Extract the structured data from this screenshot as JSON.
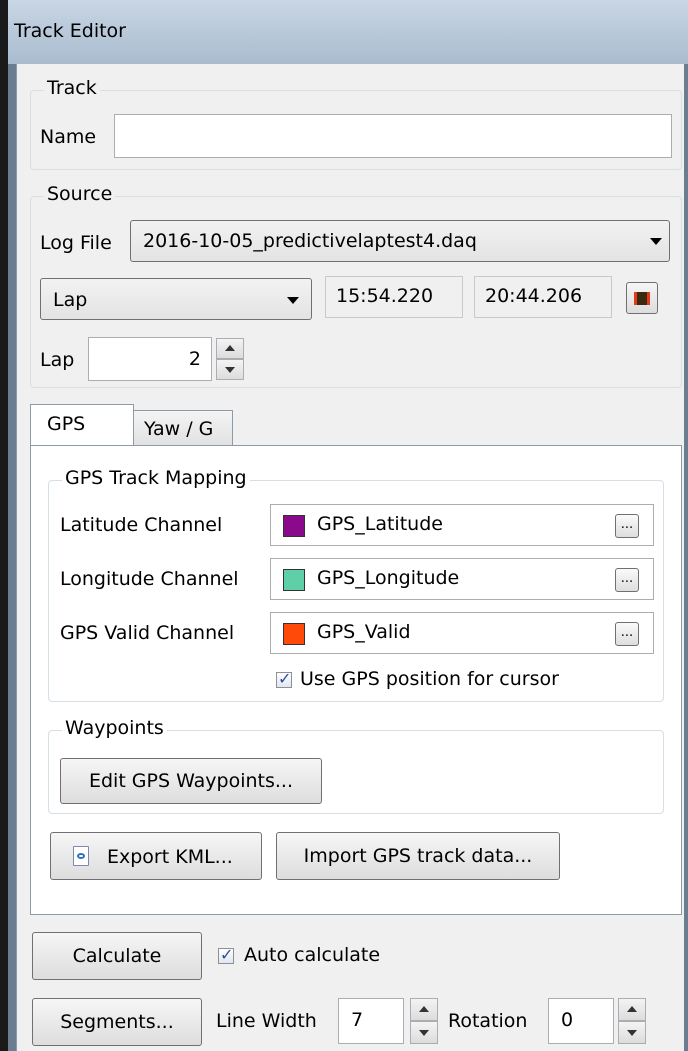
{
  "window": {
    "title": "Track Editor"
  },
  "track": {
    "group_label": "Track",
    "name_label": "Name",
    "name_value": ""
  },
  "source": {
    "group_label": "Source",
    "log_file_label": "Log File",
    "log_file_value": "2016-10-05_predictivelaptest4.daq",
    "range_mode": "Lap",
    "start_time": "15:54.220",
    "end_time": "20:44.206",
    "lap_label": "Lap",
    "lap_value": "2"
  },
  "tabs": [
    {
      "label": "GPS",
      "selected": true
    },
    {
      "label": "Yaw / G",
      "selected": false
    }
  ],
  "gps_mapping": {
    "group_label": "GPS Track Mapping",
    "rows": [
      {
        "label": "Latitude Channel",
        "channel": "GPS_Latitude",
        "color": "#8b0a8b"
      },
      {
        "label": "Longitude Channel",
        "channel": "GPS_Longitude",
        "color": "#5fcfa8"
      },
      {
        "label": "GPS Valid Channel",
        "channel": "GPS_Valid",
        "color": "#ff4a0a"
      }
    ],
    "ellipsis_label": "...",
    "use_gps_cursor_label": "Use GPS position for cursor",
    "use_gps_cursor_checked": true
  },
  "waypoints": {
    "group_label": "Waypoints",
    "edit_button": "Edit GPS Waypoints..."
  },
  "export_kml_button": "Export KML...",
  "import_gps_button": "Import GPS track data...",
  "bottom": {
    "calculate_button": "Calculate",
    "auto_calculate_label": "Auto calculate",
    "auto_calculate_checked": true,
    "segments_button": "Segments...",
    "line_width_label": "Line Width",
    "line_width_value": "7",
    "rotation_label": "Rotation",
    "rotation_value": "0"
  }
}
